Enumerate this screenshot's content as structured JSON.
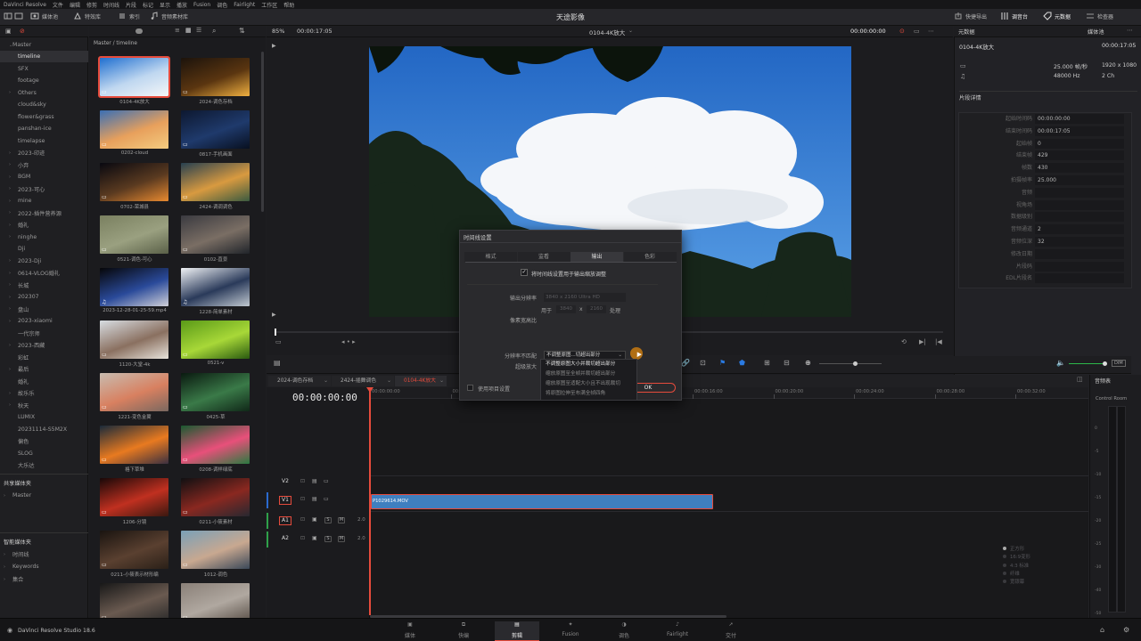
{
  "menu": [
    "DaVinci Resolve",
    "文件",
    "编辑",
    "修剪",
    "时间线",
    "片段",
    "标记",
    "显示",
    "播放",
    "Fusion",
    "调色",
    "Fairlight",
    "工作区",
    "帮助"
  ],
  "toolbar": {
    "media_pool": "媒体池",
    "effects": "特效库",
    "index": "索引",
    "sound_library": "音频素材库",
    "project_title": "天途影像",
    "quick_export": "快捷导出",
    "mixer": "调音台",
    "metadata": "元数据",
    "inspector": "检查器"
  },
  "viewer_bar": {
    "zoom": "85%",
    "duration": "00:00:17:05",
    "clip_name": "0104-4K放大",
    "timecode": "00:00:00:00"
  },
  "media_pool": {
    "breadcrumb": "Master / timeline",
    "clips": [
      {
        "label": "0104-4K放大",
        "colors": [
          "#1f6fd0",
          "#bfd7f0",
          "#f4f6f8"
        ],
        "selected": true,
        "video_icon": true,
        "audio_icon": false
      },
      {
        "label": "2024-调色存档",
        "colors": [
          "#1c130c",
          "#5a3510",
          "#f0b040"
        ],
        "selected": false,
        "video_icon": true,
        "audio_icon": false
      },
      {
        "label": "0202-cloud",
        "colors": [
          "#3a6fb5",
          "#e8a05c",
          "#f3cc80"
        ],
        "selected": false,
        "video_icon": true,
        "audio_icon": false
      },
      {
        "label": "0817-手机画面",
        "colors": [
          "#0d1830",
          "#1f3a6c",
          "#081020"
        ],
        "selected": false,
        "video_icon": true,
        "audio_icon": false
      },
      {
        "label": "0702-荣城县",
        "colors": [
          "#080810",
          "#5a3a20",
          "#e88a30"
        ],
        "selected": false,
        "video_icon": true,
        "audio_icon": false
      },
      {
        "label": "2424-调调调色",
        "colors": [
          "#274050",
          "#d89a40",
          "#3a5a40"
        ],
        "selected": false,
        "video_icon": true,
        "audio_icon": false
      },
      {
        "label": "0521-调色-可心",
        "colors": [
          "#7a8060",
          "#9aa080",
          "#5a6048"
        ],
        "selected": false,
        "video_icon": true,
        "audio_icon": false
      },
      {
        "label": "0102-直景",
        "colors": [
          "#3a3a40",
          "#7a6e64",
          "#20242a"
        ],
        "selected": false,
        "video_icon": true,
        "audio_icon": false
      },
      {
        "label": "2023-12-28-01-25-59.mp4",
        "colors": [
          "#060608",
          "#2a4a9a",
          "#d0d0d8"
        ],
        "selected": false,
        "video_icon": false,
        "audio_icon": true
      },
      {
        "label": "1228-简单素材",
        "colors": [
          "#f0f2f5",
          "#2a3a5a",
          "#c0c8d0"
        ],
        "selected": false,
        "video_icon": false,
        "audio_icon": true
      },
      {
        "label": "1120-大堂-4k",
        "colors": [
          "#d8dde2",
          "#8a7060",
          "#e8e4dc"
        ],
        "selected": false,
        "video_icon": true,
        "audio_icon": false
      },
      {
        "label": "0521-v",
        "colors": [
          "#5a9a18",
          "#a8d838",
          "#2a5a10"
        ],
        "selected": false,
        "video_icon": true,
        "audio_icon": false
      },
      {
        "label": "1221-变色金翼",
        "colors": [
          "#c8bcb0",
          "#d88060",
          "#7a6860"
        ],
        "selected": false,
        "video_icon": true,
        "audio_icon": false
      },
      {
        "label": "0425-草",
        "colors": [
          "#0a1a10",
          "#3a7a48",
          "#102818"
        ],
        "selected": false,
        "video_icon": true,
        "audio_icon": false
      },
      {
        "label": "格下草堆",
        "colors": [
          "#1a2a3a",
          "#e87a20",
          "#3a3040"
        ],
        "selected": false,
        "video_icon": true,
        "audio_icon": false
      },
      {
        "label": "0208-调样绿底",
        "colors": [
          "#1a5a30",
          "#e8507a",
          "#2a7a40"
        ],
        "selected": false,
        "video_icon": true,
        "audio_icon": false
      },
      {
        "label": "1206-分镜",
        "colors": [
          "#180808",
          "#c03020",
          "#3a1810"
        ],
        "selected": false,
        "video_icon": true,
        "audio_icon": false
      },
      {
        "label": "0211-小筱素材",
        "colors": [
          "#101012",
          "#8a2820",
          "#282830"
        ],
        "selected": false,
        "video_icon": true,
        "audio_icon": false
      },
      {
        "label": "0211-小筱表示材形编",
        "colors": [
          "#1a1410",
          "#5a4030",
          "#2a2018"
        ],
        "selected": false,
        "video_icon": true,
        "audio_icon": false
      },
      {
        "label": "1012-调色",
        "colors": [
          "#7aa0b8",
          "#c8a890",
          "#3a4858"
        ],
        "selected": false,
        "video_icon": true,
        "audio_icon": false
      },
      {
        "label": "",
        "colors": [
          "#181818",
          "#6a5a50",
          "#2a2a2a"
        ],
        "selected": false,
        "video_icon": true,
        "audio_icon": false
      },
      {
        "label": "",
        "colors": [
          "#8a8078",
          "#b0a8a0",
          "#5a5048"
        ],
        "selected": false,
        "video_icon": true,
        "audio_icon": false
      }
    ]
  },
  "tree": {
    "master": "Master",
    "items": [
      {
        "label": "timeline",
        "arrow": "",
        "selected": true
      },
      {
        "label": "SFX",
        "arrow": "",
        "selected": false
      },
      {
        "label": "footage",
        "arrow": "",
        "selected": false
      },
      {
        "label": "Others",
        "arrow": "›",
        "selected": false
      },
      {
        "label": "cloud&sky",
        "arrow": "",
        "selected": false
      },
      {
        "label": "flower&grass",
        "arrow": "",
        "selected": false
      },
      {
        "label": "panshan-ice",
        "arrow": "",
        "selected": false
      },
      {
        "label": "timelapse",
        "arrow": "",
        "selected": false
      },
      {
        "label": "2023-印迹",
        "arrow": "›",
        "selected": false
      },
      {
        "label": "小弃",
        "arrow": "›",
        "selected": false
      },
      {
        "label": "BGM",
        "arrow": "›",
        "selected": false
      },
      {
        "label": "2023-可心",
        "arrow": "›",
        "selected": false
      },
      {
        "label": "mine",
        "arrow": "›",
        "selected": false
      },
      {
        "label": "2022-插件营养源",
        "arrow": "›",
        "selected": false
      },
      {
        "label": "婚礼",
        "arrow": "›",
        "selected": false
      },
      {
        "label": "ninghe",
        "arrow": "›",
        "selected": false
      },
      {
        "label": "Dji",
        "arrow": "",
        "selected": false
      },
      {
        "label": "2023-Dji",
        "arrow": "›",
        "selected": false
      },
      {
        "label": "0614-VLOG婚礼",
        "arrow": "›",
        "selected": false
      },
      {
        "label": "长城",
        "arrow": "›",
        "selected": false
      },
      {
        "label": "202307",
        "arrow": "›",
        "selected": false
      },
      {
        "label": "盘山",
        "arrow": "›",
        "selected": false
      },
      {
        "label": "2023-xiaomi",
        "arrow": "›",
        "selected": false
      },
      {
        "label": "一代宗师",
        "arrow": "",
        "selected": false
      },
      {
        "label": "2023-西藏",
        "arrow": "›",
        "selected": false
      },
      {
        "label": "彩虹",
        "arrow": "",
        "selected": false
      },
      {
        "label": "最后",
        "arrow": "›",
        "selected": false
      },
      {
        "label": "婚礼",
        "arrow": "",
        "selected": false
      },
      {
        "label": "故乐乐",
        "arrow": "›",
        "selected": false
      },
      {
        "label": "秋天",
        "arrow": "›",
        "selected": false
      },
      {
        "label": "LUMIX",
        "arrow": "",
        "selected": false
      },
      {
        "label": "20231114-S5M2X",
        "arrow": "",
        "selected": false
      },
      {
        "label": "偏色",
        "arrow": "",
        "selected": false
      },
      {
        "label": "SLOG",
        "arrow": "",
        "selected": false
      },
      {
        "label": "大乐达",
        "arrow": "",
        "selected": false
      }
    ],
    "shared_header": "共享媒体夹",
    "shared_master": "Master",
    "smart_header": "智能媒体夹",
    "smart_items": [
      "时间线",
      "Keywords",
      "集合"
    ]
  },
  "viewer": {
    "sky_color": "#2f7ed8",
    "cloud_color": "#f4f6f9",
    "tree_color": "#18241a"
  },
  "dialog": {
    "title": "时间线设置",
    "tabs": [
      "格式",
      "监看",
      "输出",
      "色彩"
    ],
    "active_tab": "输出",
    "checkbox_label": "将时间线设置用于输出缩放调整",
    "output_res_label": "输出分辨率",
    "output_res_value": "3840 x 2160 Ultra HD",
    "for_label": "用于",
    "width": "3840",
    "x": "x",
    "height": "2160",
    "process": "处理",
    "pixel_aspect_label": "像素宽高比",
    "pixel_aspect_options": [
      "正方形",
      "16:9变形",
      "4:3 标准",
      "纤维",
      "宽银幕"
    ],
    "mismatch_label": "分辨率不匹配",
    "mismatch_value": "不调整原图...切超出部分",
    "super_scale_label": "超级放大",
    "use_project_label": "使用项目设置",
    "ok": "OK",
    "dropdown_options": [
      "不调整原图大小并裁切超出部分",
      "缩放原图至全帧并裁切超出部分",
      "缩放原图至适配大小且不出现裁切",
      "将原图拉伸至布满全帧四角"
    ]
  },
  "inspector": {
    "header": "元数据",
    "media_pool_label": "媒体池",
    "clip_name": "0104-4K放大",
    "duration": "00:00:17:05",
    "fps": "25.000 帧/秒",
    "resolution": "1920 x 1080",
    "audio_rate": "48000 Hz",
    "channels": "2 Ch",
    "details_title": "片段详情",
    "rows": [
      {
        "k": "起始时间码",
        "v": "00:00:00:00"
      },
      {
        "k": "结束时间码",
        "v": "00:00:17:05"
      },
      {
        "k": "起始帧",
        "v": "0"
      },
      {
        "k": "结束帧",
        "v": "429"
      },
      {
        "k": "帧数",
        "v": "430"
      },
      {
        "k": "拍摄帧率",
        "v": "25.000"
      },
      {
        "k": "音频",
        "v": ""
      },
      {
        "k": "视角场",
        "v": ""
      },
      {
        "k": "数据级别",
        "v": ""
      },
      {
        "k": "音频通道",
        "v": "2"
      },
      {
        "k": "音频位深",
        "v": "32"
      },
      {
        "k": "修改日期",
        "v": ""
      },
      {
        "k": "片段码",
        "v": ""
      },
      {
        "k": "EDL片段名",
        "v": ""
      }
    ]
  },
  "timeline": {
    "tabs": [
      "2024-调色存档",
      "2424-插舞调色",
      "0104-4K放大"
    ],
    "timecode": "00:00:00:00",
    "ruler": [
      "00:00:00:00",
      "00:00:04:00",
      "00:00:08:00",
      "00:00:12:00",
      "00:00:16:00",
      "00:00:20:00",
      "00:00:24:00",
      "00:00:28:00",
      "00:00:32:00"
    ],
    "tracks": [
      {
        "id": "V2",
        "type": "video"
      },
      {
        "id": "V1",
        "type": "video"
      },
      {
        "id": "A1",
        "type": "audio",
        "level": "2.0"
      },
      {
        "id": "A2",
        "type": "audio",
        "level": "2.0"
      }
    ],
    "clip_name": "P1029614.MOV",
    "clip_color": "#3f7fbf",
    "mixer_title": "音频表",
    "control_room": "Control Room",
    "mixer_scale": [
      "0",
      "-5",
      "-10",
      "-15",
      "-20",
      "-25",
      "-30",
      "-40",
      "-50"
    ]
  },
  "pages": [
    "媒体",
    "快编",
    "剪辑",
    "Fusion",
    "调色",
    "Fairlight",
    "交付"
  ],
  "active_page": "剪辑",
  "footer": {
    "app_version": "DaVinci Resolve Studio 18.6"
  },
  "accent": "#e64b3c"
}
